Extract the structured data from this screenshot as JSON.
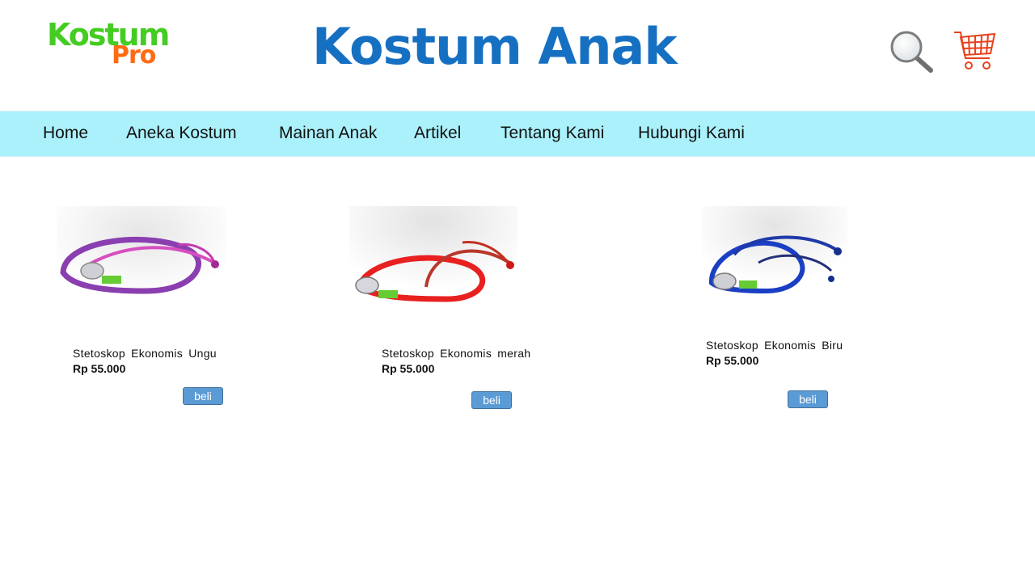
{
  "header": {
    "logo_main": "Kostum",
    "logo_sub": "Pro",
    "title": "Kostum Anak",
    "search_icon": "search-icon",
    "cart_icon": "cart-icon"
  },
  "colors": {
    "title_blue": "#1670c2",
    "nav_bg": "#aaf1fb",
    "logo_green": "#44cc22",
    "logo_orange": "#ff6a13",
    "cart_red": "#e8421c",
    "button_blue": "#5b9bd5"
  },
  "nav": {
    "items": [
      {
        "label": "Home"
      },
      {
        "label": "Aneka Kostum"
      },
      {
        "label": "Mainan Anak"
      },
      {
        "label": "Artikel"
      },
      {
        "label": "Tentang Kami"
      },
      {
        "label": "Hubungi Kami"
      }
    ]
  },
  "products": [
    {
      "name": "Stetoskop Ekonomis Ungu",
      "price": "Rp 55.000",
      "button": "beli",
      "color": "#8a3fb0"
    },
    {
      "name": "Stetoskop Ekonomis merah",
      "price": "Rp 55.000",
      "button": "beli",
      "color": "#e82020"
    },
    {
      "name": "Stetoskop Ekonomis Biru",
      "price": "Rp 55.000",
      "button": "beli",
      "color": "#1a3fc4"
    }
  ]
}
